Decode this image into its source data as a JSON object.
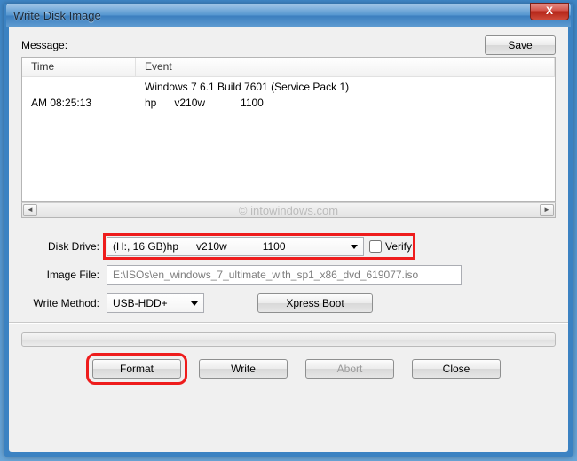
{
  "window": {
    "title": "Write Disk Image",
    "close": "X"
  },
  "msg_label": "Message:",
  "save_label": "Save",
  "list": {
    "col_time": "Time",
    "col_event": "Event",
    "row1_time": "",
    "row1_event": "Windows 7 6.1 Build 7601 (Service Pack 1)",
    "row2_time": "AM 08:25:13",
    "row2_event": "hp      v210w            1100"
  },
  "watermark": "© intowindows.com",
  "labels": {
    "disk_drive": "Disk Drive:",
    "image_file": "Image File:",
    "write_method": "Write Method:"
  },
  "fields": {
    "disk_drive_value": "(H:, 16 GB)hp      v210w            1100",
    "verify_label": "Verify",
    "image_file_value": "E:\\ISOs\\en_windows_7_ultimate_with_sp1_x86_dvd_619077.iso",
    "write_method_value": "USB-HDD+",
    "xpress_boot": "Xpress Boot"
  },
  "buttons": {
    "format": "Format",
    "write": "Write",
    "abort": "Abort",
    "close": "Close"
  }
}
